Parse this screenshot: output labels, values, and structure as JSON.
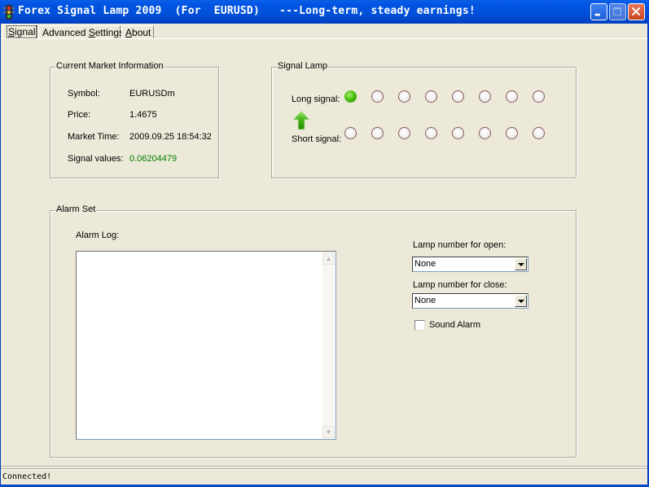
{
  "window": {
    "title": "Forex Signal Lamp 2009  (For  EURUSD)   ---Long-term, steady earnings!",
    "minimize_label": "_",
    "maximize_label": "□",
    "close_label": "✕"
  },
  "tabs": [
    {
      "label_mnemonic": "S",
      "label_rest": "ignal",
      "active": true
    },
    {
      "label_pre": "Advanced ",
      "label_mnemonic": "S",
      "label_rest": "ettings",
      "active": false
    },
    {
      "label_mnemonic": "A",
      "label_rest": "bout",
      "active": false
    }
  ],
  "market_info": {
    "group_label": "Current Market Information",
    "rows": [
      {
        "label": "Symbol:",
        "value": "EURUSDm"
      },
      {
        "label": "Price:",
        "value": "1.4675"
      },
      {
        "label": "Market Time:",
        "value": "2009.09.25 18:54:32"
      },
      {
        "label": "Signal values:",
        "value": "0.06204479"
      }
    ],
    "signal_value_color": "#008000"
  },
  "signal_lamp": {
    "group_label": "Signal Lamp",
    "long_label": "Long signal:",
    "short_label": "Short signal:",
    "direction_icon": "up-arrow-icon",
    "long_lamps": [
      true,
      false,
      false,
      false,
      false,
      false,
      false,
      false
    ],
    "short_lamps": [
      false,
      false,
      false,
      false,
      false,
      false,
      false,
      false
    ],
    "lamp_on_color": "#4cc010"
  },
  "alarm_set": {
    "group_label": "Alarm Set",
    "log_label": "Alarm Log:",
    "log_text": "",
    "open_label": "Lamp number for open:",
    "open_value": "None",
    "close_label": "Lamp number for close:",
    "close_value": "None",
    "sound_alarm_label": "Sound Alarm",
    "sound_alarm_checked": false,
    "scroll_up": "▲",
    "scroll_down": "▼"
  },
  "status": {
    "text": "Connected!"
  }
}
